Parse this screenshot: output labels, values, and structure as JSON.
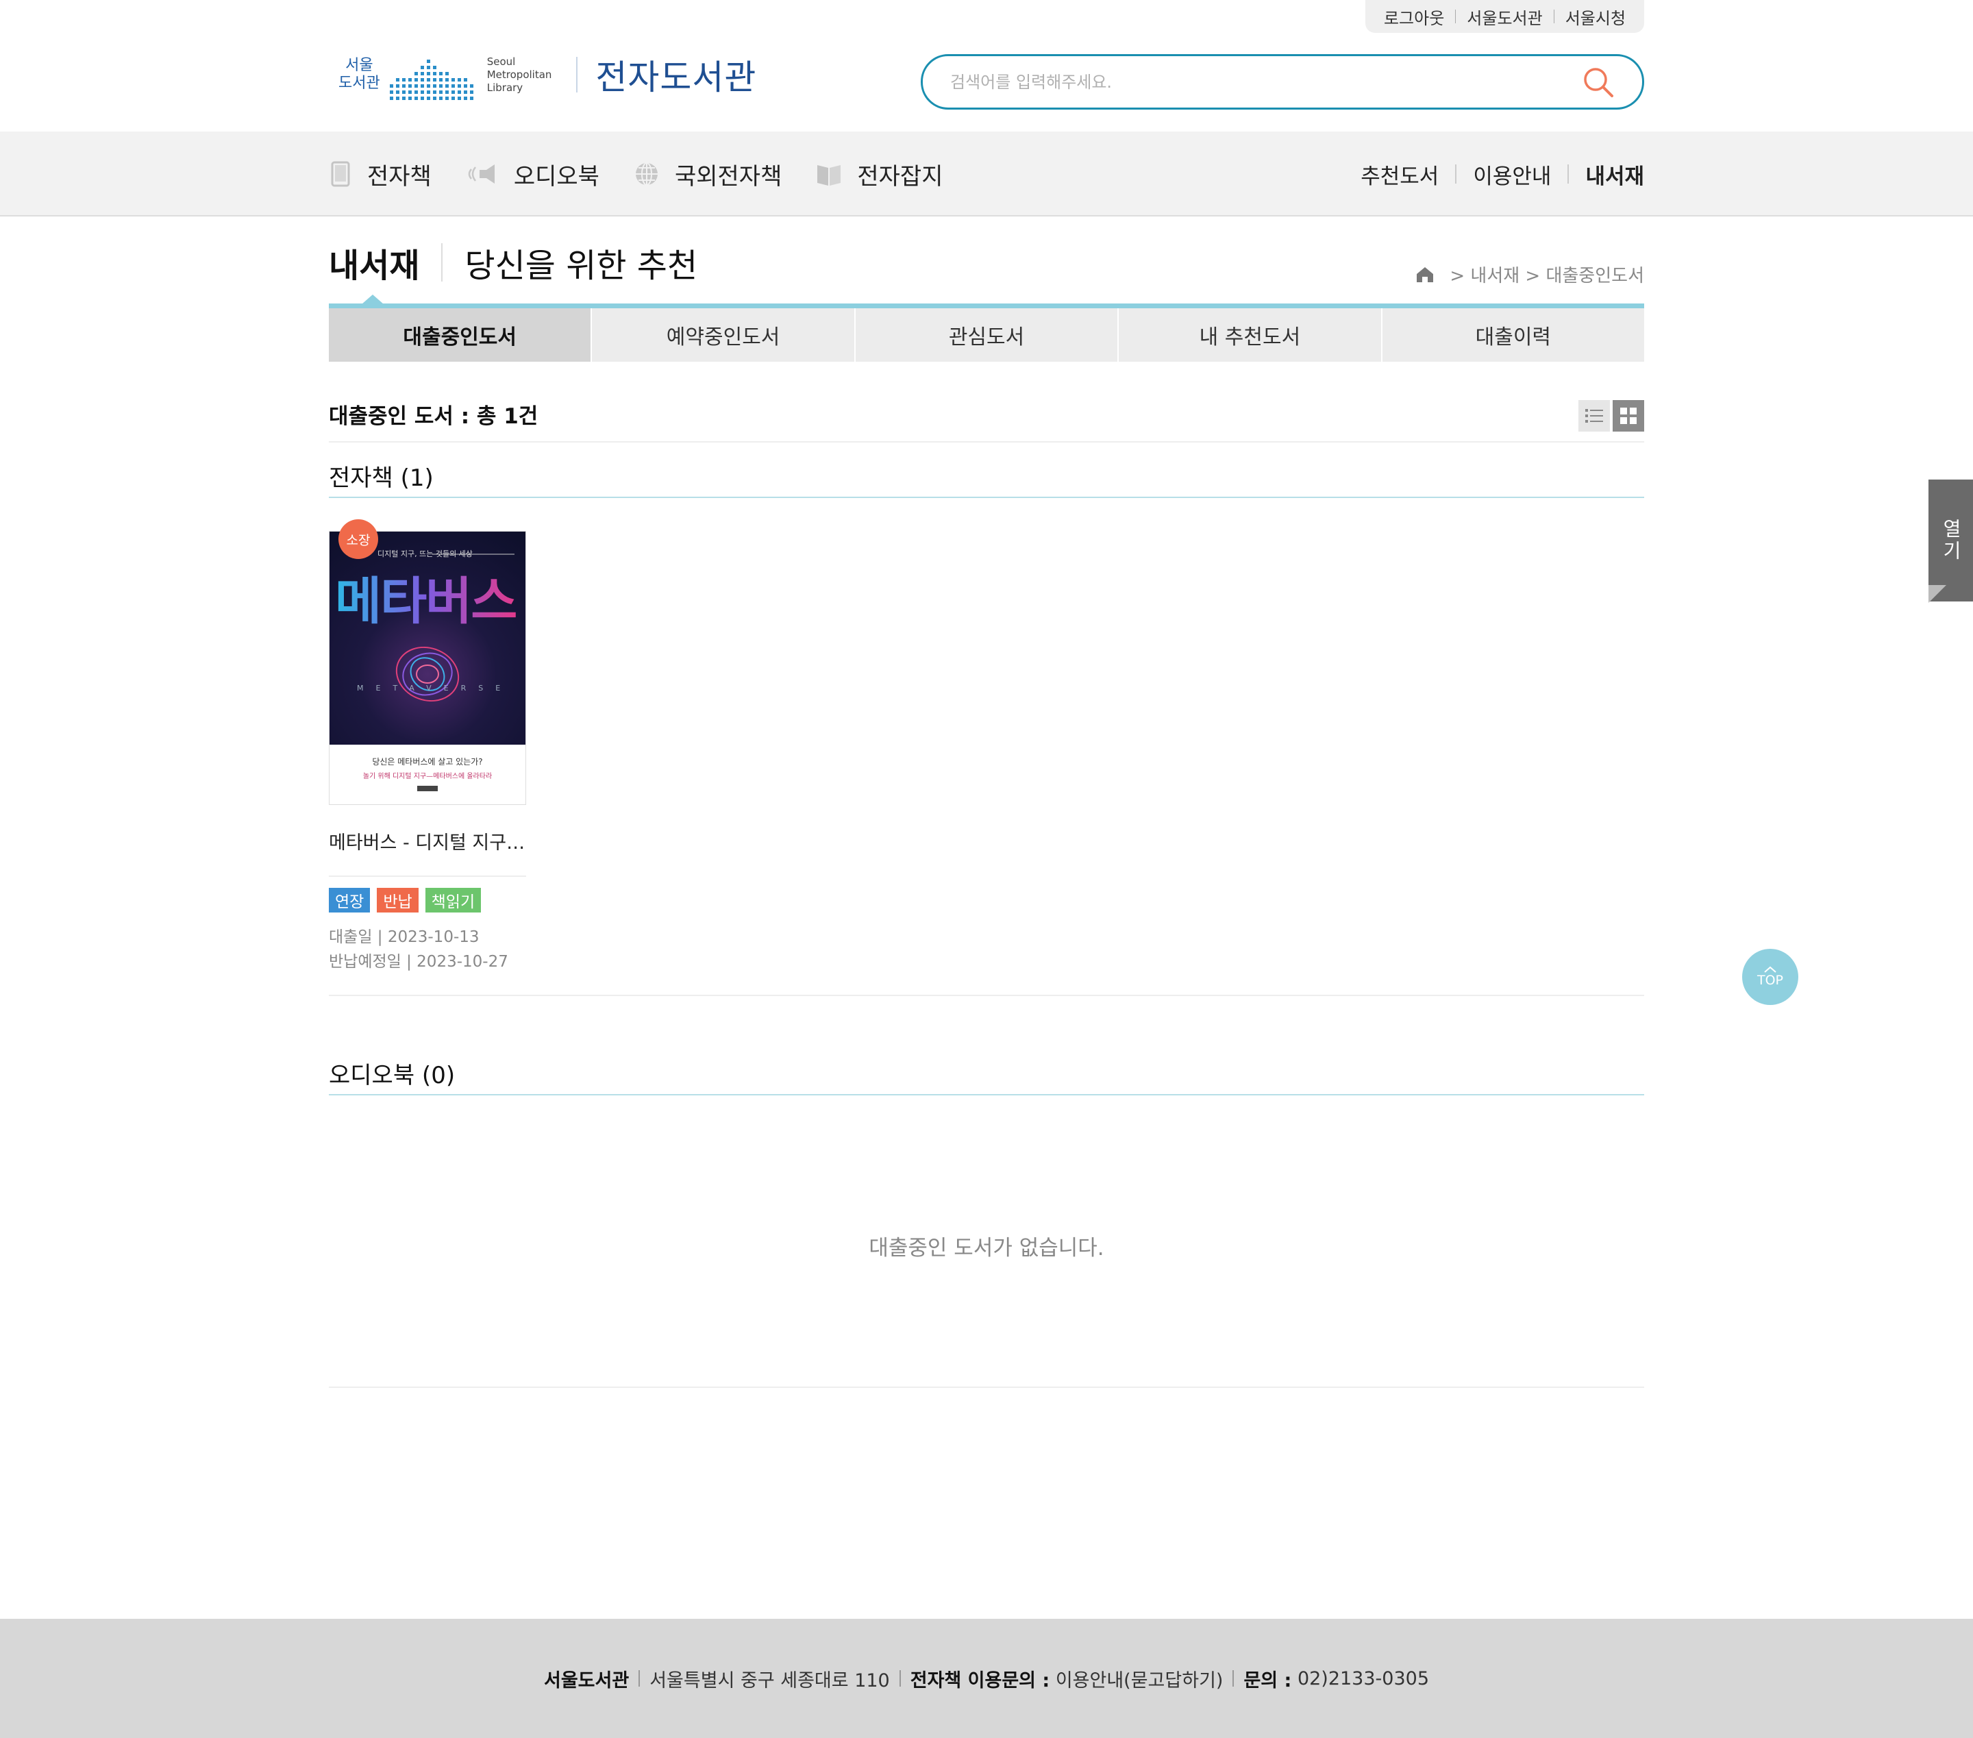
{
  "util": {
    "logout": "로그아웃",
    "seoul_library": "서울도서관",
    "seoul_city": "서울시청"
  },
  "logo": {
    "kr_line1": "서울",
    "kr_line2": "도서관",
    "en_line1": "Seoul",
    "en_line2": "Metropolitan",
    "en_line3": "Library",
    "site_title": "전자도서관"
  },
  "search": {
    "placeholder": "검색어를 입력해주세요."
  },
  "gnb": {
    "items": [
      {
        "label": "전자책",
        "icon": "tablet-icon"
      },
      {
        "label": "오디오북",
        "icon": "speaker-icon"
      },
      {
        "label": "국외전자책",
        "icon": "globe-icon"
      },
      {
        "label": "전자잡지",
        "icon": "magazine-icon"
      }
    ],
    "right": [
      "추천도서",
      "이용안내",
      "내서재"
    ]
  },
  "page": {
    "title": "내서재",
    "subtitle": "당신을 위한 추천",
    "breadcrumb": "> 내서재 > 대출중인도서"
  },
  "tabs": [
    "대출중인도서",
    "예약중인도서",
    "관심도서",
    "내 추천도서",
    "대출이력"
  ],
  "summary": "대출중인 도서 : 총 1건",
  "sections": {
    "ebook_title": "전자책 (1)",
    "audiobook_title": "오디오북 (0)",
    "audiobook_empty": "대출중인 도서가 없습니다."
  },
  "book": {
    "badge": "소장",
    "cover_subtitle": "디지털 지구, 뜨는 것들의 세상",
    "cover_title": "메타버스",
    "cover_meta": "METAVERSE",
    "cover_line1": "당신은 메타버스에 살고 있는가?",
    "cover_line2": "놀기 위해 디지털 지구—메타버스에 올라타라",
    "title": "메타버스 - 디지털 지구, 뜨는 것들의 세상",
    "tags": {
      "extend": "연장",
      "return": "반납",
      "read": "책읽기"
    },
    "loan_date": "대출일 | 2023-10-13",
    "due_date": "반납예정일 | 2023-10-27"
  },
  "side": {
    "open_tab": "열기",
    "top_button": "TOP"
  },
  "footer": {
    "org": "서울도서관",
    "address": "서울특별시 중구 세종대로 110",
    "inquiry_label": "전자책 이용문의 :",
    "inquiry_value": "이용안내(묻고답하기)",
    "phone_label": "문의 :",
    "phone_value": "02)2133-0305"
  },
  "colors": {
    "accent": "#1a8fb0",
    "tab_line": "#8ccfdf",
    "badge": "#f06a4a",
    "tag_extend": "#3a8fd4",
    "tag_return": "#f06a4a",
    "tag_read": "#6cc56c"
  }
}
